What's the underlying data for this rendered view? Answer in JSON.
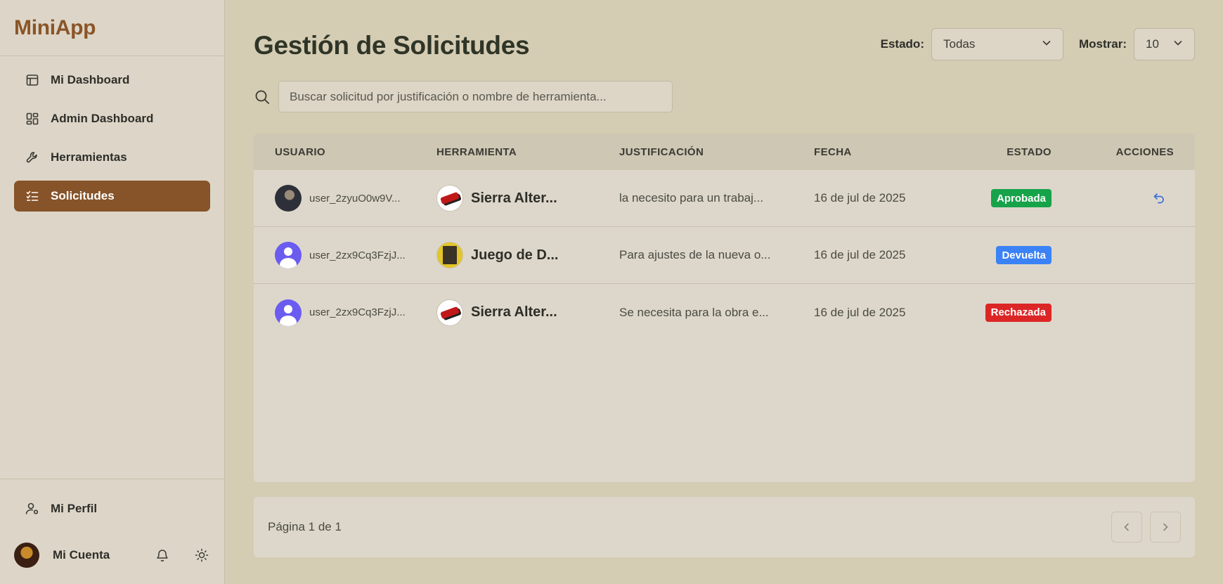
{
  "app": {
    "name": "MiniApp"
  },
  "sidebar": {
    "items": [
      {
        "label": "Mi Dashboard",
        "icon": "calendar-icon"
      },
      {
        "label": "Admin Dashboard",
        "icon": "grid-icon"
      },
      {
        "label": "Herramientas",
        "icon": "wrench-icon"
      },
      {
        "label": "Solicitudes",
        "icon": "checklist-icon",
        "active": true
      }
    ],
    "profile_label": "Mi Perfil",
    "account_label": "Mi Cuenta"
  },
  "page": {
    "title": "Gestión de Solicitudes",
    "estado_label": "Estado:",
    "estado_value": "Todas",
    "mostrar_label": "Mostrar:",
    "mostrar_value": "10",
    "search_placeholder": "Buscar solicitud por justificación o nombre de herramienta..."
  },
  "table": {
    "headers": [
      "USUARIO",
      "HERRAMIENTA",
      "JUSTIFICACIÓN",
      "FECHA",
      "ESTADO",
      "ACCIONES"
    ],
    "rows": [
      {
        "user": "user_2zyuO0w9V...",
        "tool": "Sierra Alter...",
        "justification": "la necesito para un trabaj...",
        "date": "16 de jul de 2025",
        "status": "Aprobada",
        "status_color": "#17a34a"
      },
      {
        "user": "user_2zx9Cq3FzjJ...",
        "tool": "Juego de D...",
        "justification": "Para ajustes de la nueva o...",
        "date": "16 de jul de 2025",
        "status": "Devuelta",
        "status_color": "#3b82f6"
      },
      {
        "user": "user_2zx9Cq3FzjJ...",
        "tool": "Sierra Alter...",
        "justification": "Se necesita para la obra e...",
        "date": "16 de jul de 2025",
        "status": "Rechazada",
        "status_color": "#dc2626"
      }
    ]
  },
  "pagination": {
    "info": "Página 1 de 1"
  },
  "colors": {
    "accent": "#875329",
    "background": "#d4ccb3",
    "sidebar": "#ddd6c8"
  }
}
